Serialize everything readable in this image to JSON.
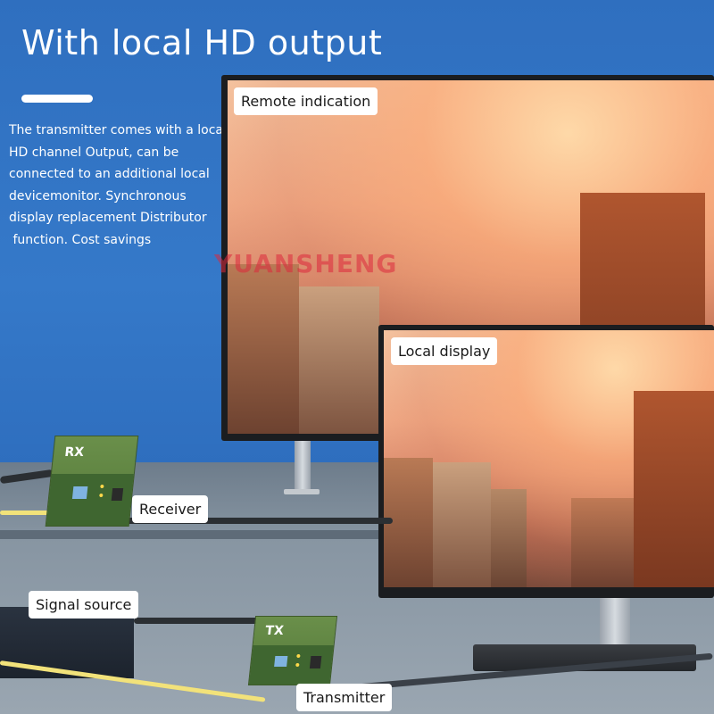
{
  "heading": "With local HD output",
  "description_lines": [
    "The transmitter comes with a local",
    "HD channel Output, can be",
    "connected to an additional local",
    "devicemonitor. Synchronous",
    "display replacement Distributor",
    " function. Cost savings"
  ],
  "watermark": "YUANSHENG",
  "labels": {
    "remote": "Remote indication",
    "local": "Local display",
    "receiver": "Receiver",
    "source": "Signal source",
    "transmitter": "Transmitter"
  },
  "device_marks": {
    "rx": "RX",
    "tx": "TX"
  },
  "colors": {
    "background": "#3579c9",
    "device_green": "#5f8642",
    "fiber_yellow": "#f2e27a"
  }
}
